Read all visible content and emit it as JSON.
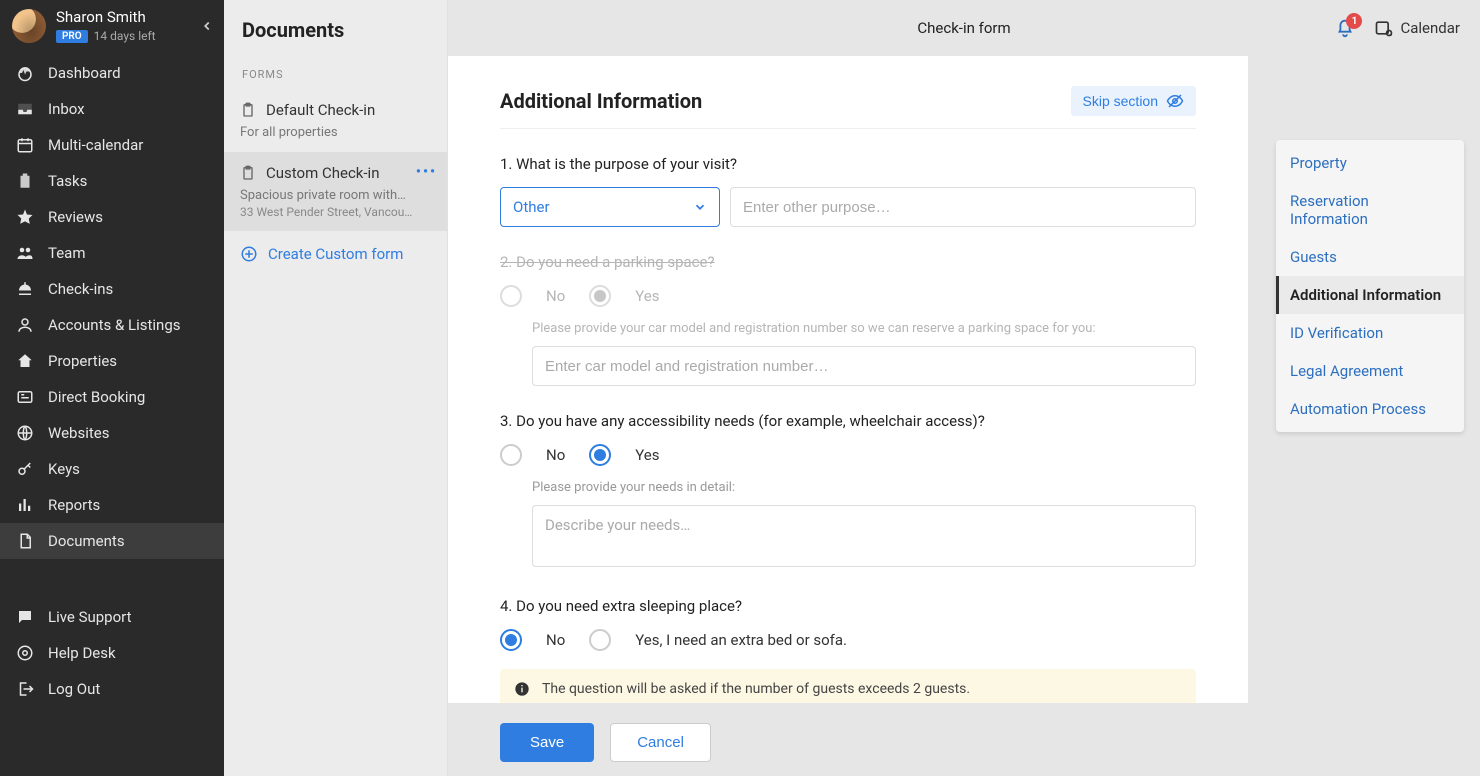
{
  "profile": {
    "name": "Sharon Smith",
    "badge": "PRO",
    "trial": "14 days left"
  },
  "sidebar": {
    "items": [
      {
        "icon": "gauge",
        "label": "Dashboard"
      },
      {
        "icon": "inbox",
        "label": "Inbox"
      },
      {
        "icon": "calendar",
        "label": "Multi-calendar"
      },
      {
        "icon": "tasks",
        "label": "Tasks"
      },
      {
        "icon": "star",
        "label": "Reviews"
      },
      {
        "icon": "team",
        "label": "Team"
      },
      {
        "icon": "bell-desk",
        "label": "Check-ins"
      },
      {
        "icon": "accounts",
        "label": "Accounts & Listings"
      },
      {
        "icon": "home",
        "label": "Properties"
      },
      {
        "icon": "direct",
        "label": "Direct Booking"
      },
      {
        "icon": "globe",
        "label": "Websites"
      },
      {
        "icon": "key",
        "label": "Keys"
      },
      {
        "icon": "reports",
        "label": "Reports"
      },
      {
        "icon": "documents",
        "label": "Documents"
      }
    ],
    "bottom": [
      {
        "icon": "chat",
        "label": "Live Support"
      },
      {
        "icon": "help",
        "label": "Help Desk"
      },
      {
        "icon": "logout",
        "label": "Log Out"
      }
    ]
  },
  "formscol": {
    "title": "Documents",
    "sectionLabel": "FORMS",
    "items": [
      {
        "name": "Default Check-in",
        "sub1": "For all properties"
      },
      {
        "name": "Custom Check-in",
        "sub1": "Spacious private room with…",
        "sub2": "33 West Pender Street, Vancou…"
      }
    ],
    "create": "Create Custom form"
  },
  "topbar": {
    "title": "Check-in form",
    "notifCount": "1",
    "calendar": "Calendar"
  },
  "section": {
    "title": "Additional Information",
    "skip": "Skip section",
    "q1": {
      "text": "1. What is the purpose of your visit?",
      "selectValue": "Other",
      "otherPlaceholder": "Enter other purpose…"
    },
    "q2": {
      "text": "2. Do you need a parking space?",
      "no": "No",
      "yes": "Yes",
      "helper": "Please provide your car model and registration number so we can reserve a parking space for you:",
      "placeholder": "Enter car model and registration number…"
    },
    "q3": {
      "text": "3. Do you have any accessibility needs (for example, wheelchair access)?",
      "no": "No",
      "yes": "Yes",
      "helper": "Please provide your needs in detail:",
      "placeholder": "Describe your needs…"
    },
    "q4": {
      "text": "4. Do you need extra sleeping place?",
      "no": "No",
      "yes": "Yes, I need an extra bed or sofa.",
      "info": "The question will be asked if the number of guests exceeds 2 guests."
    }
  },
  "footer": {
    "save": "Save",
    "cancel": "Cancel"
  },
  "rightnav": {
    "items": [
      "Property",
      "Reservation Information",
      "Guests",
      "Additional Information",
      "ID Verification",
      "Legal Agreement",
      "Automation Process"
    ],
    "activeIndex": 3
  }
}
